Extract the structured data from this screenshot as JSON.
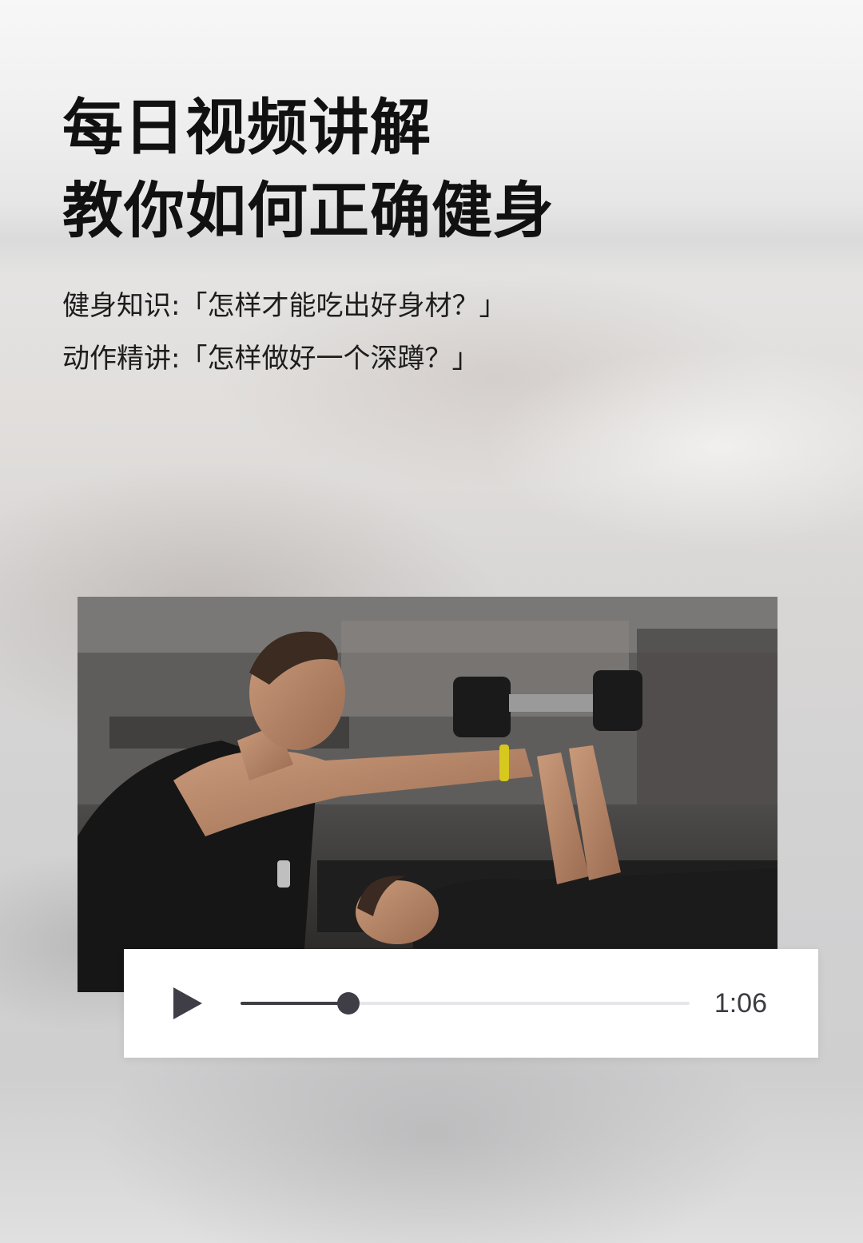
{
  "headline": {
    "line1": "每日视频讲解",
    "line2": "教你如何正确健身"
  },
  "info": {
    "row1": "健身知识:「怎样才能吃出好身材？」",
    "row2": "动作精讲:「怎样做好一个深蹲？」"
  },
  "photo": {
    "subject": "gym trainer spotting woman doing dumbbell press"
  },
  "player": {
    "play_icon": "play-icon",
    "progress": 0.24,
    "duration": "1:06",
    "colors": {
      "control": "#3f3d46",
      "track": "#e6e6ea",
      "background": "#ffffff"
    }
  }
}
